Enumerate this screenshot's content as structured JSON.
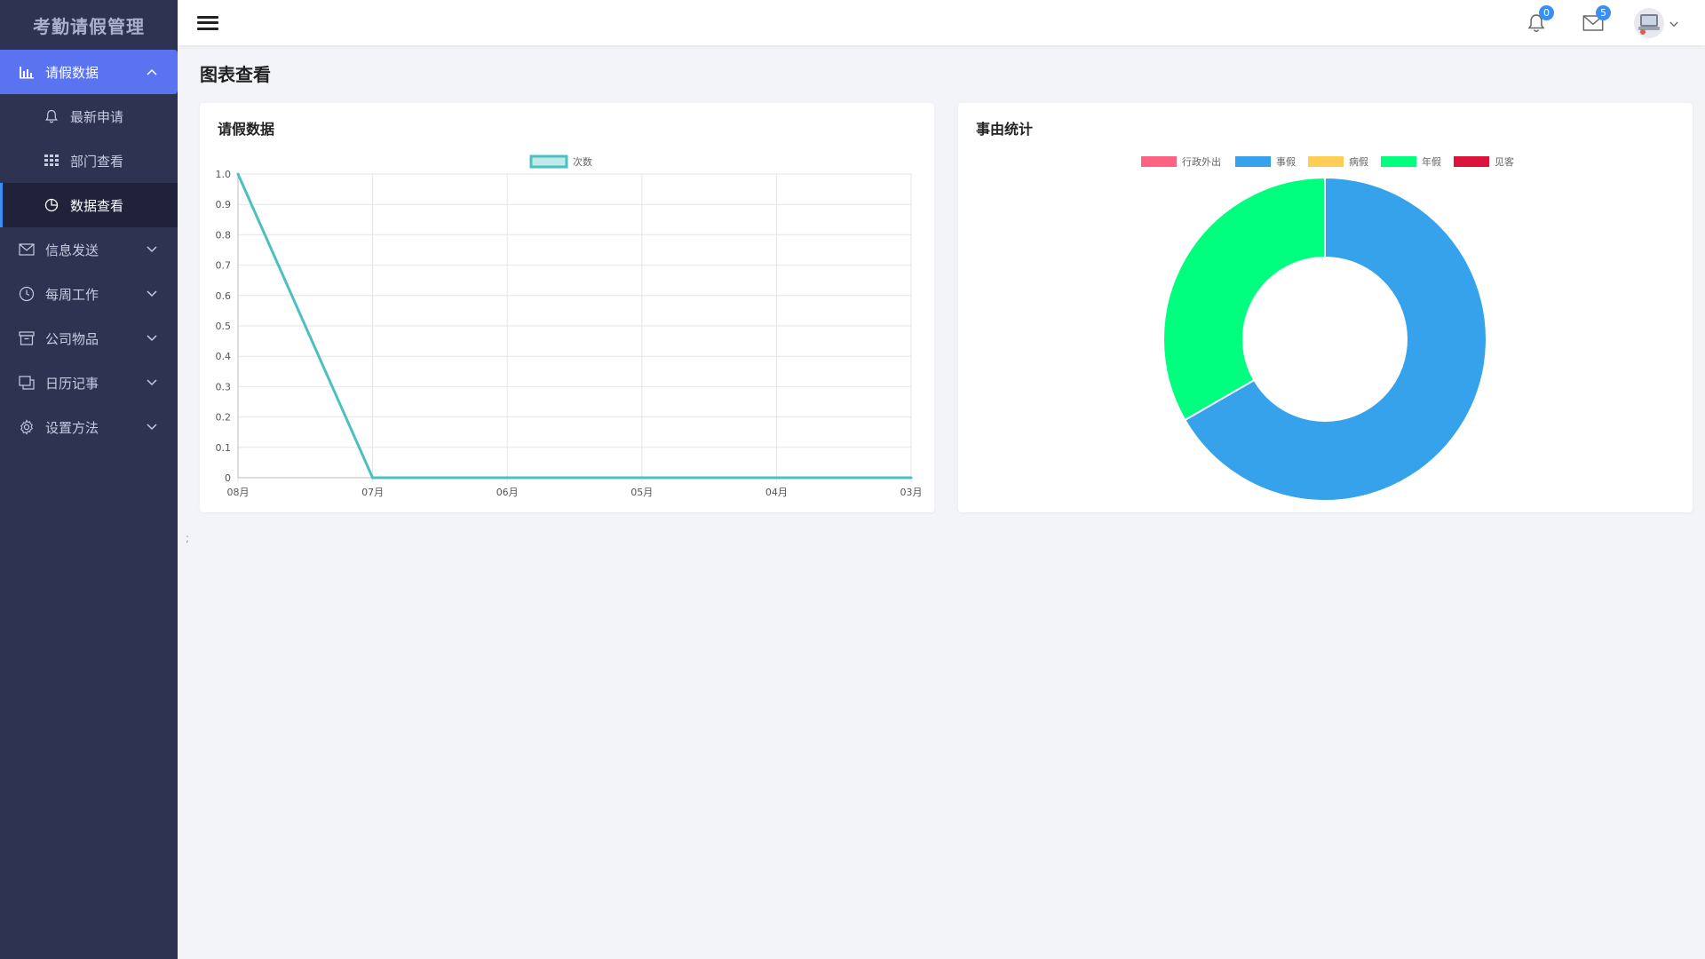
{
  "app": {
    "title": "考勤请假管理"
  },
  "sidebar": {
    "items": [
      {
        "label": "请假数据",
        "icon": "bar-chart-icon",
        "expanded": true,
        "children": [
          {
            "label": "最新申请",
            "icon": "bell-icon"
          },
          {
            "label": "部门查看",
            "icon": "grid-icon"
          },
          {
            "label": "数据查看",
            "icon": "pie-chart-icon",
            "active": true
          }
        ]
      },
      {
        "label": "信息发送",
        "icon": "mail-icon"
      },
      {
        "label": "每周工作",
        "icon": "clock-icon"
      },
      {
        "label": "公司物品",
        "icon": "box-icon"
      },
      {
        "label": "日历记事",
        "icon": "copy-icon"
      },
      {
        "label": "设置方法",
        "icon": "gear-icon"
      }
    ]
  },
  "header": {
    "notifications": {
      "count": "0",
      "icon": "bell-icon"
    },
    "messages": {
      "count": "5",
      "icon": "mail-icon"
    },
    "user": {
      "icon": "avatar-icon"
    }
  },
  "main": {
    "page_title": "图表查看",
    "left_card": {
      "title": "请假数据"
    },
    "right_card": {
      "title": "事由统计"
    }
  },
  "chart_data": [
    {
      "type": "line",
      "title": "请假数据",
      "x": [
        "08月",
        "07月",
        "06月",
        "05月",
        "04月",
        "03月"
      ],
      "series": [
        {
          "name": "次数",
          "values": [
            1,
            0,
            0,
            0,
            0,
            0
          ],
          "color": "#4bc0c0"
        }
      ],
      "ylim": [
        0,
        1.0
      ],
      "yticks": [
        "1.0",
        "0.9",
        "0.8",
        "0.7",
        "0.6",
        "0.5",
        "0.4",
        "0.3",
        "0.2",
        "0.1",
        "0"
      ],
      "legend": "top",
      "grid": true
    },
    {
      "type": "pie",
      "donut": true,
      "title": "事由统计",
      "categories": [
        "行政外出",
        "事假",
        "病假",
        "年假",
        "见客"
      ],
      "values": [
        0,
        2,
        0,
        1,
        0
      ],
      "colors": [
        "#ff6384",
        "#36a2eb",
        "#ffce56",
        "#00ff7f",
        "#dc143c"
      ],
      "legend": "top"
    }
  ]
}
